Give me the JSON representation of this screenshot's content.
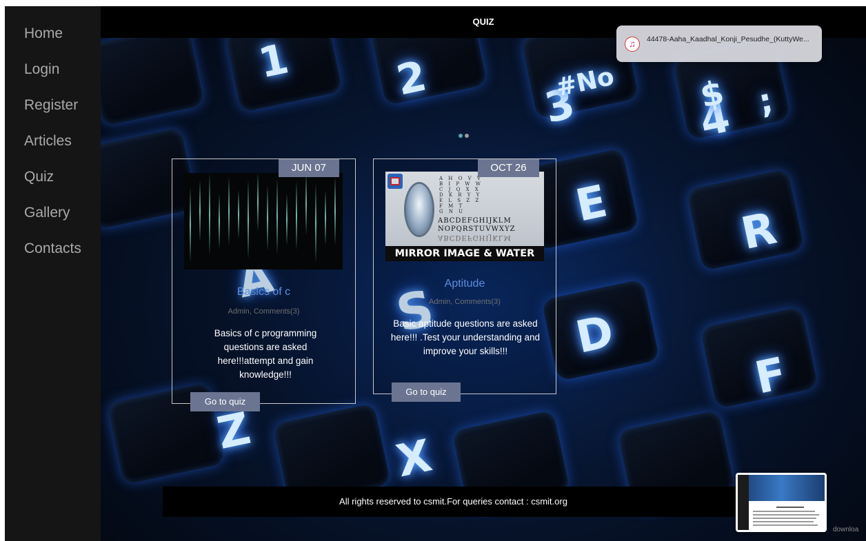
{
  "sidebar": {
    "items": [
      {
        "label": "Home"
      },
      {
        "label": "Login"
      },
      {
        "label": "Register"
      },
      {
        "label": "Articles"
      },
      {
        "label": "Quiz"
      },
      {
        "label": "Gallery"
      },
      {
        "label": "Contacts"
      }
    ]
  },
  "header": {
    "title": "QUIZ"
  },
  "notification": {
    "icon": "music-note-icon",
    "text": "44478-Aaha_Kaadhal_Konji_Pesudhe_(KuttyWe..."
  },
  "carousel": {
    "dots": 2,
    "active_dot": 0
  },
  "background": {
    "keys": [
      "1",
      "2",
      "3",
      "4",
      "E",
      "R",
      "A",
      "S",
      "D",
      "F",
      "X",
      "Z"
    ],
    "key_symbols": [
      "#No",
      "$",
      ";"
    ]
  },
  "cards": [
    {
      "date": "JUN 07",
      "title": "Basics of c",
      "meta": "Admin, Comments(3)",
      "description": "Basics of c programming questions are asked here!!!attempt and gain knowledge!!!",
      "button": "Go to quiz"
    },
    {
      "date": "OCT 26",
      "title": "Aptitude",
      "meta": "Admin, Comments(3)",
      "description": "Basic aptitude questions are asked here!!! .Test your understanding and improve your skills!!!",
      "button": "Go to quiz",
      "image": {
        "banner": "MIRROR IMAGE & WATER IMAGE",
        "alphabet_1": "ABCDEFGHIJKLM",
        "alphabet_2": "NOPQRSTUVWXYZ"
      }
    }
  ],
  "footer": {
    "text": "All rights reserved to csmit.For queries contact : csmit.org"
  },
  "overlay": {
    "download_label": "downloa"
  },
  "colors": {
    "sidebar_bg": "#151515",
    "nav_text": "#a9a9a9",
    "accent_button": "#6b7591",
    "card_title": "#5b8fe0",
    "dot_active": "#4fa8a8",
    "dot_inactive": "#9a9a9a"
  }
}
